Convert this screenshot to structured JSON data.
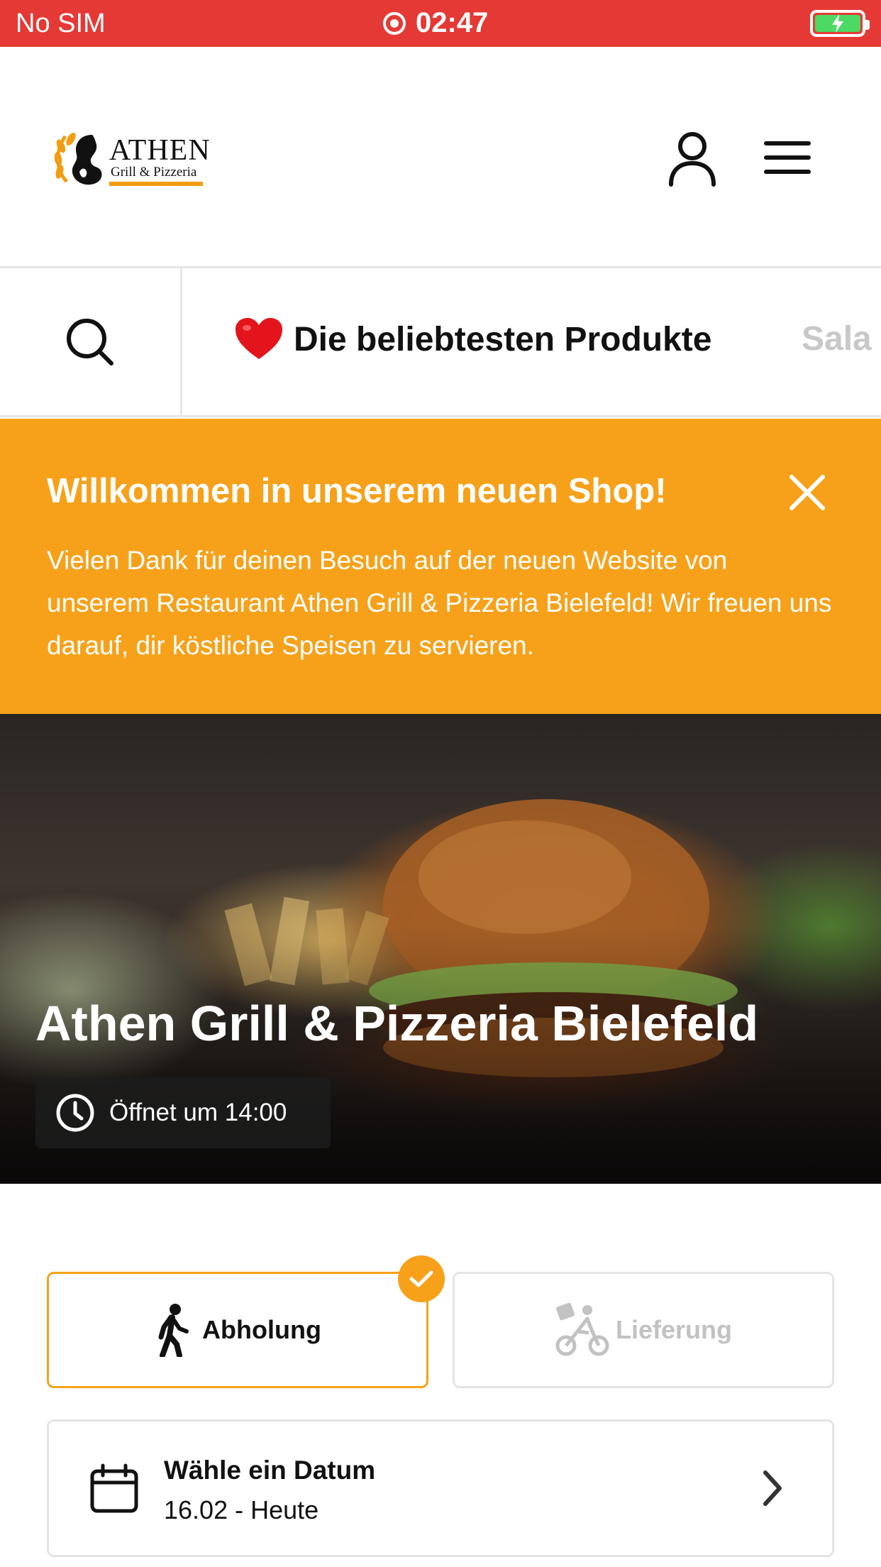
{
  "status_bar": {
    "carrier": "No SIM",
    "time": "02:47",
    "recording_icon": "record-icon",
    "battery_icon": "battery-charging-icon",
    "background_color": "#e53935"
  },
  "header": {
    "logo": {
      "name": "ATHEN",
      "subtitle": "Grill & Pizzeria"
    },
    "account_icon": "user-icon",
    "menu_icon": "hamburger-icon"
  },
  "category_bar": {
    "search_icon": "search-icon",
    "active_category": {
      "icon": "heart-icon",
      "label": "Die beliebtesten Produkte"
    },
    "next_category": "Sala"
  },
  "welcome_banner": {
    "title": "Willkommen in unserem neuen Shop!",
    "text": "Vielen Dank für deinen Besuch auf der neuen Website von unserem Restaurant Athen Grill & Pizzeria Bielefeld! Wir freuen uns darauf, dir köstliche Speisen zu servieren.",
    "close_icon": "close-icon",
    "background_color": "#f7a11a"
  },
  "hero": {
    "restaurant_name": "Athen Grill & Pizzeria Bielefeld",
    "opening_status": "Öffnet um 14:00",
    "status_icon": "clock-icon"
  },
  "order_mode": {
    "pickup_label": "Abholung",
    "pickup_icon": "walking-person-icon",
    "pickup_selected": true,
    "delivery_label": "Lieferung",
    "delivery_icon": "bicycle-icon",
    "accent_color": "#f7a11a"
  },
  "date_picker": {
    "title": "Wähle ein Datum",
    "value": "16.02 - Heute",
    "icon": "calendar-icon",
    "chevron_icon": "chevron-right-icon"
  }
}
